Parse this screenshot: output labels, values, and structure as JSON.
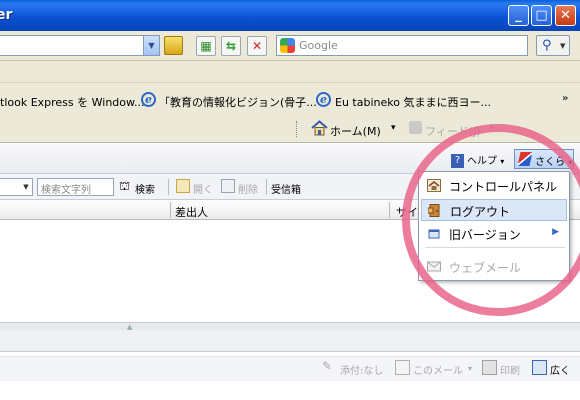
{
  "window": {
    "title_fragment": "er",
    "minimize_glyph": "_",
    "maximize_glyph": "□",
    "close_glyph": "✕"
  },
  "addressbar": {
    "search_placeholder": "Google"
  },
  "links_bar": {
    "items": [
      "tlook Express を Window...",
      "「教育の情報化ビジョン(骨子...",
      "Eu tabineko 気ままに西ヨー..."
    ],
    "overflow_glyph": "»"
  },
  "command_bar": {
    "home_label": "ホーム(M)",
    "feed_label": "フィード(J)",
    "dropdown_glyph": "▾"
  },
  "webmail": {
    "help_label": "ヘルプ",
    "help_arrow": "▾",
    "account_label": "さくら",
    "account_arrow": "▾",
    "toolbar": {
      "keyword_placeholder": "検索文字列",
      "search_label": "検索",
      "open_label": "開く",
      "delete_label": "削除",
      "inbox_label": "受信箱"
    },
    "columns": {
      "sender": "差出人",
      "size_fragment": "サイ"
    },
    "bottom_toolbar": {
      "attachment_label": "添付:なし",
      "this_mail_label": "このメール",
      "this_mail_arrow": "▾",
      "print_label": "印刷",
      "expand_label": "広く"
    }
  },
  "account_menu": {
    "items": [
      {
        "label": "コントロールパネル",
        "highlighted": false,
        "enabled": true,
        "submenu": false
      },
      {
        "label": "ログアウト",
        "highlighted": true,
        "enabled": true,
        "submenu": false
      },
      {
        "label": "旧バージョン",
        "highlighted": false,
        "enabled": true,
        "submenu": true
      },
      {
        "label": "ウェブメール",
        "highlighted": false,
        "enabled": false,
        "submenu": false
      }
    ],
    "submenu_glyph": "▶"
  },
  "annotation": {
    "ring_color": "#e86086"
  }
}
